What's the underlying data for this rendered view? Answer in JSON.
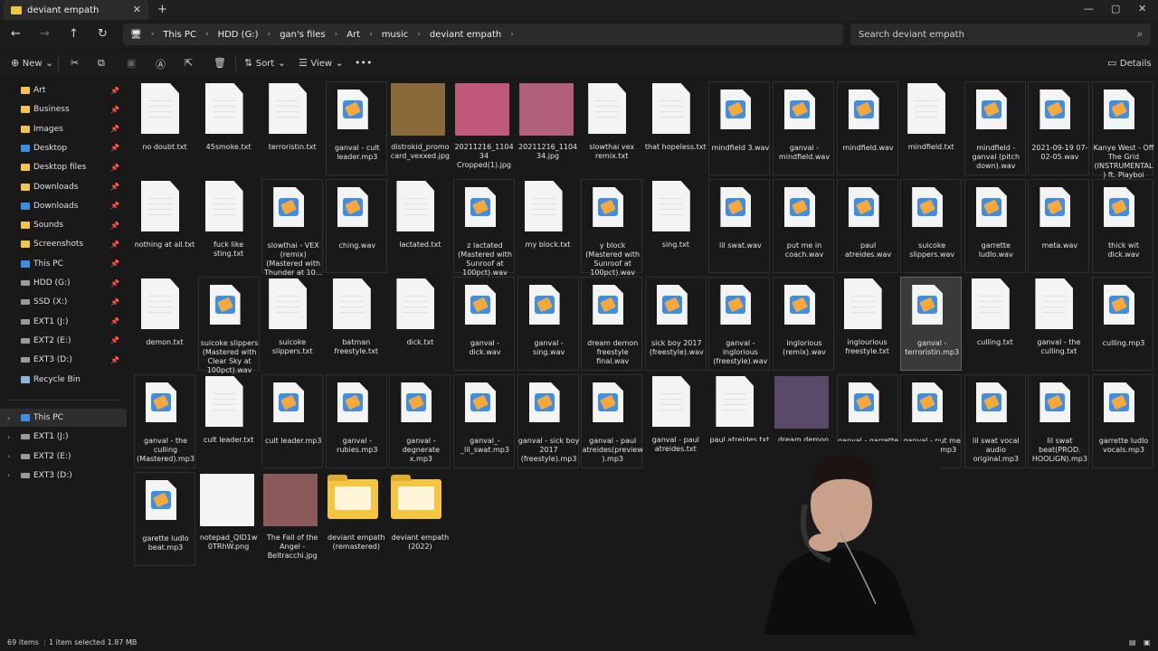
{
  "window": {
    "tab_title": "deviant empath",
    "close_tab": "✕",
    "new_tab": "+",
    "minimize": "—",
    "maximize": "▢",
    "close": "✕"
  },
  "nav": {
    "back": "←",
    "forward": "→",
    "up": "↑",
    "refresh": "↻"
  },
  "breadcrumb": {
    "items": [
      "This PC",
      "HDD (G:)",
      "gan's files",
      "Art",
      "music",
      "deviant empath"
    ]
  },
  "search": {
    "placeholder": "Search deviant empath"
  },
  "toolbar": {
    "new_label": "New",
    "sort_label": "Sort",
    "view_label": "View",
    "more": "•••",
    "details_label": "Details"
  },
  "sidebar": {
    "pinned": [
      {
        "label": "Art",
        "icon": "folder"
      },
      {
        "label": "Business",
        "icon": "folder"
      },
      {
        "label": "Images",
        "icon": "folder"
      },
      {
        "label": "Desktop",
        "icon": "blue"
      },
      {
        "label": "Desktop files",
        "icon": "folder"
      },
      {
        "label": "Downloads",
        "icon": "folder"
      },
      {
        "label": "Downloads",
        "icon": "blue"
      },
      {
        "label": "Sounds",
        "icon": "folder"
      },
      {
        "label": "Screenshots",
        "icon": "folder"
      },
      {
        "label": "This PC",
        "icon": "blue"
      },
      {
        "label": "HDD (G:)",
        "icon": "drive"
      },
      {
        "label": "SSD (X:)",
        "icon": "drive"
      },
      {
        "label": "EXT1 (J:)",
        "icon": "drive"
      },
      {
        "label": "EXT2 (E:)",
        "icon": "drive"
      },
      {
        "label": "EXT3 (D:)",
        "icon": "drive"
      },
      {
        "label": "Recycle Bin",
        "icon": "trash"
      }
    ],
    "tree": [
      {
        "label": "This PC",
        "icon": "blue"
      },
      {
        "label": "EXT1 (J:)",
        "icon": "drive"
      },
      {
        "label": "EXT2 (E:)",
        "icon": "drive"
      },
      {
        "label": "EXT3 (D:)",
        "icon": "drive"
      }
    ]
  },
  "files": [
    {
      "name": "no doubt.txt",
      "type": "doc"
    },
    {
      "name": "45smoke.txt",
      "type": "doc"
    },
    {
      "name": "terroristin.txt",
      "type": "doc"
    },
    {
      "name": "ganval - cult leader.mp3",
      "type": "audio"
    },
    {
      "name": "distrokid_promocard_vexxed.jpg",
      "type": "img",
      "color": "#8a6a3a"
    },
    {
      "name": "20211216_110434 Cropped(1).jpg",
      "type": "img",
      "color": "#c15a7a"
    },
    {
      "name": "20211216_110434.jpg",
      "type": "img",
      "color": "#b1607a"
    },
    {
      "name": "slowthai vex remix.txt",
      "type": "doc"
    },
    {
      "name": "that hopeless.txt",
      "type": "doc"
    },
    {
      "name": "mindfield 3.wav",
      "type": "audio"
    },
    {
      "name": "ganval - mindfield.wav",
      "type": "audio"
    },
    {
      "name": "mindfield.wav",
      "type": "audio"
    },
    {
      "name": "mindfield.txt",
      "type": "doc"
    },
    {
      "name": "mindfield - ganval (pitch down).wav",
      "type": "audio"
    },
    {
      "name": "2021-09-19 07-02-05.wav",
      "type": "audio"
    },
    {
      "name": "Kanye West - Off The Grid (INSTRUMENTAL) ft. Playboi Car...",
      "type": "audio"
    },
    {
      "name": "nothing at all.txt",
      "type": "doc"
    },
    {
      "name": "fuck like sting.txt",
      "type": "doc"
    },
    {
      "name": "slowthai - VEX (remix) (Mastered with Thunder at 10...",
      "type": "audio"
    },
    {
      "name": "ching.wav",
      "type": "audio"
    },
    {
      "name": "lactated.txt",
      "type": "doc"
    },
    {
      "name": "z lactated (Mastered with Sunroof at 100pct).wav",
      "type": "audio"
    },
    {
      "name": "my block.txt",
      "type": "doc"
    },
    {
      "name": "y block (Mastered with Sunroof at 100pct).wav",
      "type": "audio"
    },
    {
      "name": "sing.txt",
      "type": "doc"
    },
    {
      "name": "lil swat.wav",
      "type": "audio"
    },
    {
      "name": "put me in coach.wav",
      "type": "audio"
    },
    {
      "name": "paul atreides.wav",
      "type": "audio"
    },
    {
      "name": "suicoke slippers.wav",
      "type": "audio"
    },
    {
      "name": "garrette ludlo.wav",
      "type": "audio"
    },
    {
      "name": "meta.wav",
      "type": "audio"
    },
    {
      "name": "thick wit dick.wav",
      "type": "audio"
    },
    {
      "name": "demon.txt",
      "type": "doc"
    },
    {
      "name": "suicoke slippers (Mastered with Clear Sky at 100pct).wav",
      "type": "audio"
    },
    {
      "name": "suicoke slippers.txt",
      "type": "doc"
    },
    {
      "name": "batman freestyle.txt",
      "type": "doc"
    },
    {
      "name": "dick.txt",
      "type": "doc"
    },
    {
      "name": "ganval - dick.wav",
      "type": "audio"
    },
    {
      "name": "ganval - sing.wav",
      "type": "audio"
    },
    {
      "name": "dream demon freestyle final.wav",
      "type": "audio"
    },
    {
      "name": "sick boy 2017 (freestyle).wav",
      "type": "audio"
    },
    {
      "name": "ganval - inglorious (freestyle).wav",
      "type": "audio"
    },
    {
      "name": "inglorious (remix).wav",
      "type": "audio"
    },
    {
      "name": "inglourious freestyle.txt",
      "type": "doc"
    },
    {
      "name": "ganval - terroristin.mp3",
      "type": "audio",
      "selected": true
    },
    {
      "name": "culling.txt",
      "type": "doc"
    },
    {
      "name": "ganval - the culling.txt",
      "type": "doc"
    },
    {
      "name": "culling.mp3",
      "type": "audio"
    },
    {
      "name": "ganval - the culling (Mastered).mp3",
      "type": "audio"
    },
    {
      "name": "cult leader.txt",
      "type": "doc"
    },
    {
      "name": "cult leader.mp3",
      "type": "audio"
    },
    {
      "name": "ganval - rubies.mp3",
      "type": "audio"
    },
    {
      "name": "ganval - degnerate x.mp3",
      "type": "audio"
    },
    {
      "name": "ganval_-_lil_swat.mp3",
      "type": "audio"
    },
    {
      "name": "ganval - sick boy 2017 (freestyle).mp3",
      "type": "audio"
    },
    {
      "name": "ganval - paul atreides(preview).mp3",
      "type": "audio"
    },
    {
      "name": "ganval - paul atreides.txt",
      "type": "doc"
    },
    {
      "name": "paul atreides.txt",
      "type": "doc"
    },
    {
      "name": "dream demon freestyle live.mp4",
      "type": "img",
      "color": "#5a4a6a"
    },
    {
      "name": "ganval - garrette ludlo.mp3",
      "type": "audio"
    },
    {
      "name": "ganval - put me in coach.mp3",
      "type": "audio"
    },
    {
      "name": "lil swat vocal audio original.mp3",
      "type": "audio"
    },
    {
      "name": "lil swat beat(PROD. HOOLiGN).mp3",
      "type": "audio"
    },
    {
      "name": "garrette ludlo vocals.mp3",
      "type": "audio"
    },
    {
      "name": "garette ludlo beat.mp3",
      "type": "audio"
    },
    {
      "name": "notepad_QID1w0TRhW.png",
      "type": "img",
      "color": "#f4f4f4"
    },
    {
      "name": "The Fall of the Angel - Beltracchi.jpg",
      "type": "img",
      "color": "#8a5a5a"
    },
    {
      "name": "deviant empath (remastered)",
      "type": "folder"
    },
    {
      "name": "deviant empath (2022)",
      "type": "folder"
    }
  ],
  "status": {
    "count": "69 items",
    "selection": "1 item selected  1.87 MB"
  }
}
